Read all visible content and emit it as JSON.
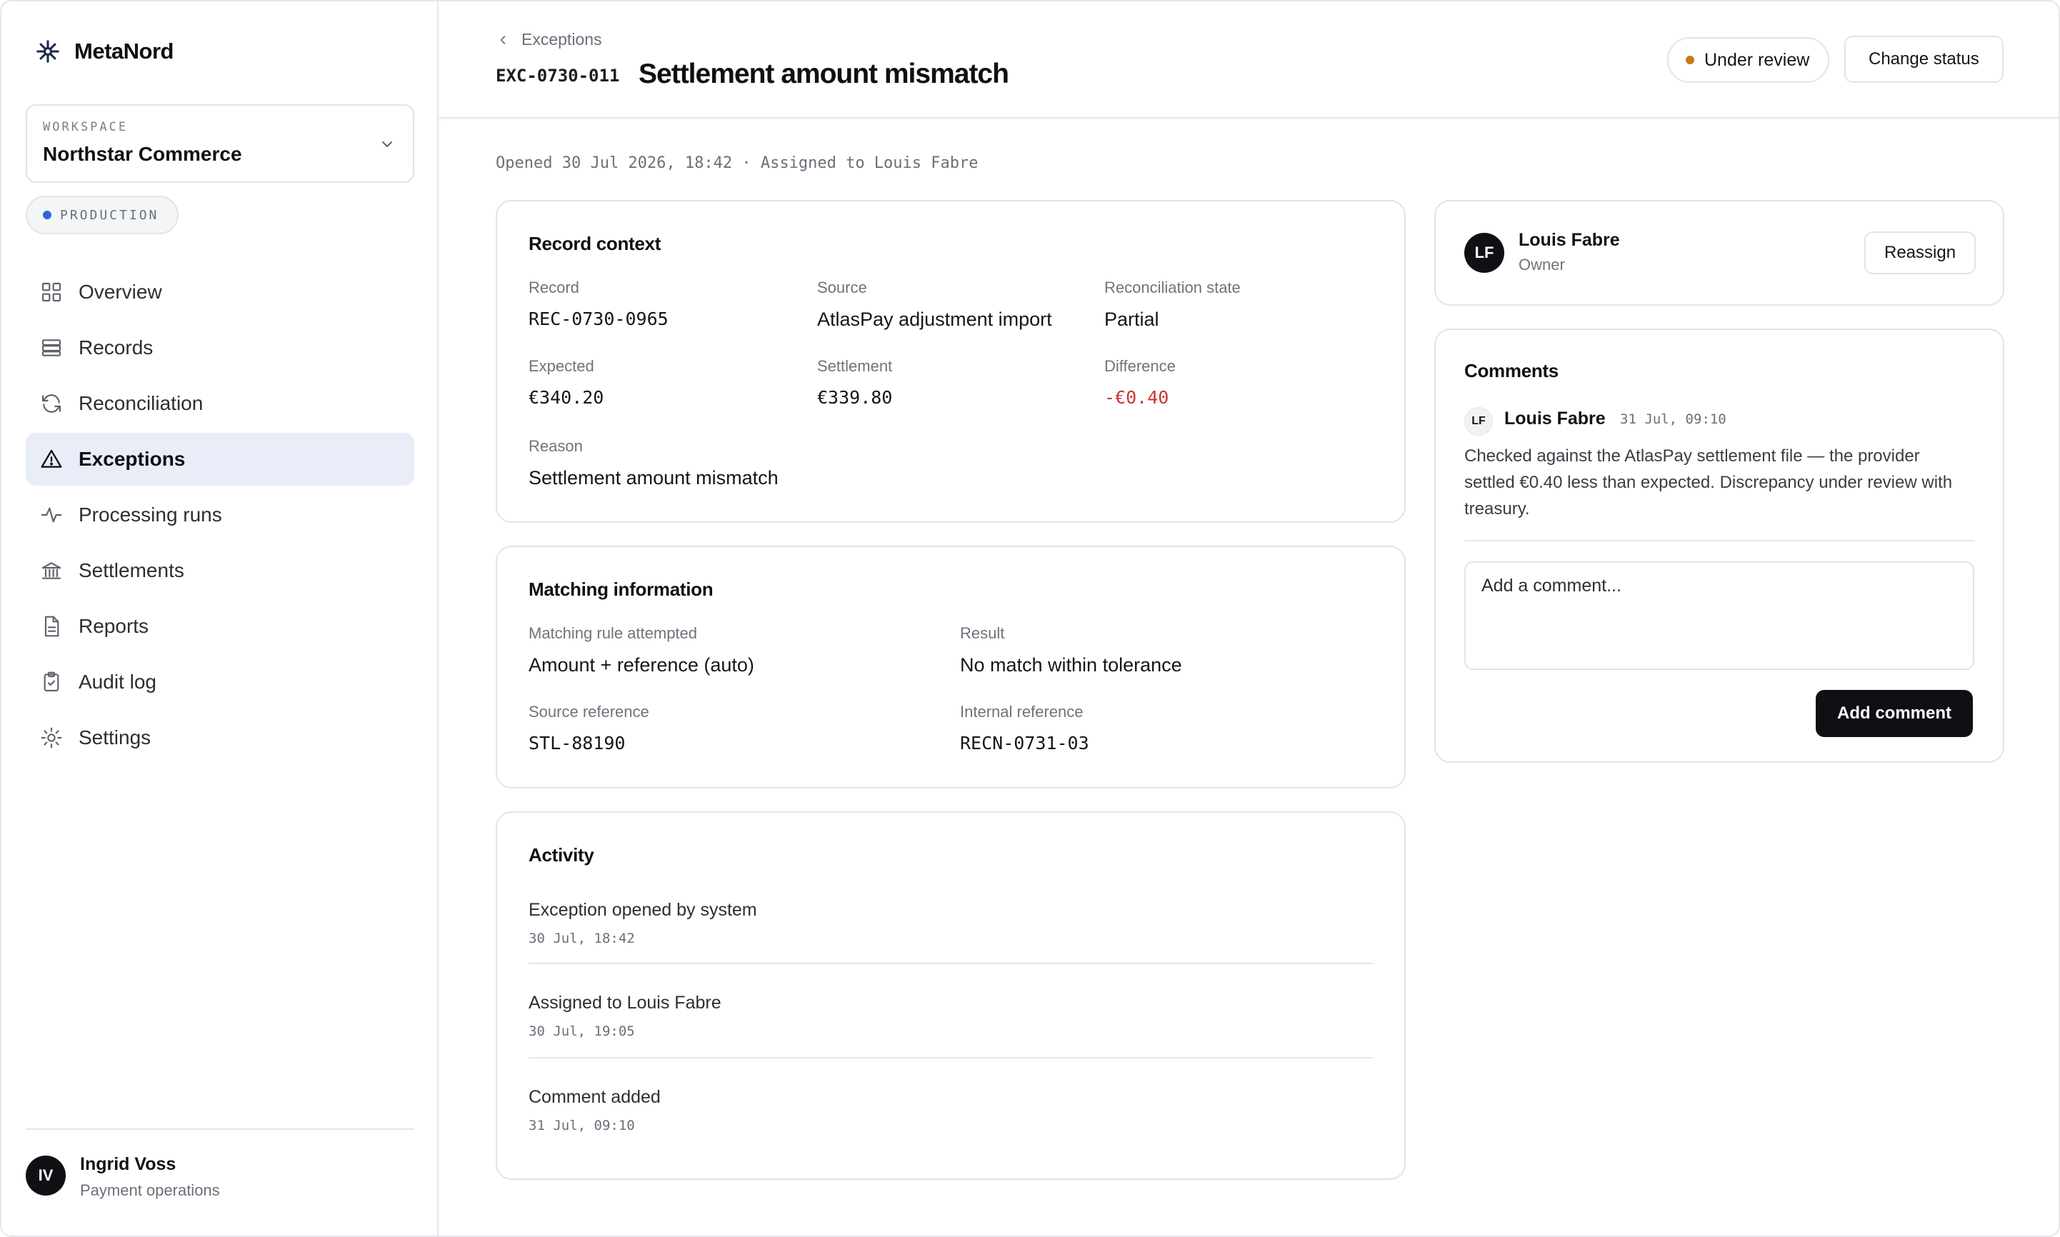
{
  "brand": {
    "name": "MetaNord"
  },
  "workspace": {
    "label": "WORKSPACE",
    "name": "Northstar Commerce",
    "environment": "PRODUCTION"
  },
  "nav": {
    "items": [
      {
        "label": "Overview",
        "icon": "grid-icon"
      },
      {
        "label": "Records",
        "icon": "database-icon"
      },
      {
        "label": "Reconciliation",
        "icon": "refresh-icon"
      },
      {
        "label": "Exceptions",
        "icon": "warning-triangle-icon",
        "active": true
      },
      {
        "label": "Processing runs",
        "icon": "activity-icon"
      },
      {
        "label": "Settlements",
        "icon": "bank-icon"
      },
      {
        "label": "Reports",
        "icon": "document-icon"
      },
      {
        "label": "Audit log",
        "icon": "clipboard-check-icon"
      },
      {
        "label": "Settings",
        "icon": "gear-icon"
      }
    ]
  },
  "user": {
    "initials": "IV",
    "name": "Ingrid Voss",
    "role": "Payment operations"
  },
  "header": {
    "breadcrumb": "Exceptions",
    "exception_id": "EXC-0730-011",
    "title": "Settlement amount mismatch",
    "status": "Under review",
    "status_color": "#c47a1c",
    "change_status_label": "Change status"
  },
  "opened_line": "Opened 30 Jul 2026, 18:42 · Assigned to Louis Fabre",
  "record_context": {
    "title": "Record context",
    "record_label": "Record",
    "record_value": "REC-0730-0965",
    "source_label": "Source",
    "source_value": "AtlasPay adjustment import",
    "state_label": "Reconciliation state",
    "state_value": "Partial",
    "expected_label": "Expected",
    "expected_value": "€340.20",
    "settlement_label": "Settlement",
    "settlement_value": "€339.80",
    "difference_label": "Difference",
    "difference_value": "-€0.40",
    "reason_label": "Reason",
    "reason_value": "Settlement amount mismatch"
  },
  "matching": {
    "title": "Matching information",
    "rule_label": "Matching rule attempted",
    "rule_value": "Amount + reference (auto)",
    "result_label": "Result",
    "result_value": "No match within tolerance",
    "source_ref_label": "Source reference",
    "source_ref_value": "STL-88190",
    "internal_ref_label": "Internal reference",
    "internal_ref_value": "RECN-0731-03"
  },
  "activity": {
    "title": "Activity",
    "items": [
      {
        "title": "Exception opened by system",
        "time": "30 Jul, 18:42"
      },
      {
        "title": "Assigned to Louis Fabre",
        "time": "30 Jul, 19:05"
      },
      {
        "title": "Comment added",
        "time": "31 Jul, 09:10"
      }
    ]
  },
  "owner": {
    "initials": "LF",
    "name": "Louis Fabre",
    "role": "Owner",
    "reassign_label": "Reassign"
  },
  "comments": {
    "title": "Comments",
    "items": [
      {
        "initials": "LF",
        "author": "Louis Fabre",
        "time": "31 Jul, 09:10",
        "body": "Checked against the AtlasPay settlement file — the provider settled €0.40 less than expected. Discrepancy under review with treasury."
      }
    ],
    "input_placeholder": "Add a comment...",
    "add_label": "Add comment"
  }
}
